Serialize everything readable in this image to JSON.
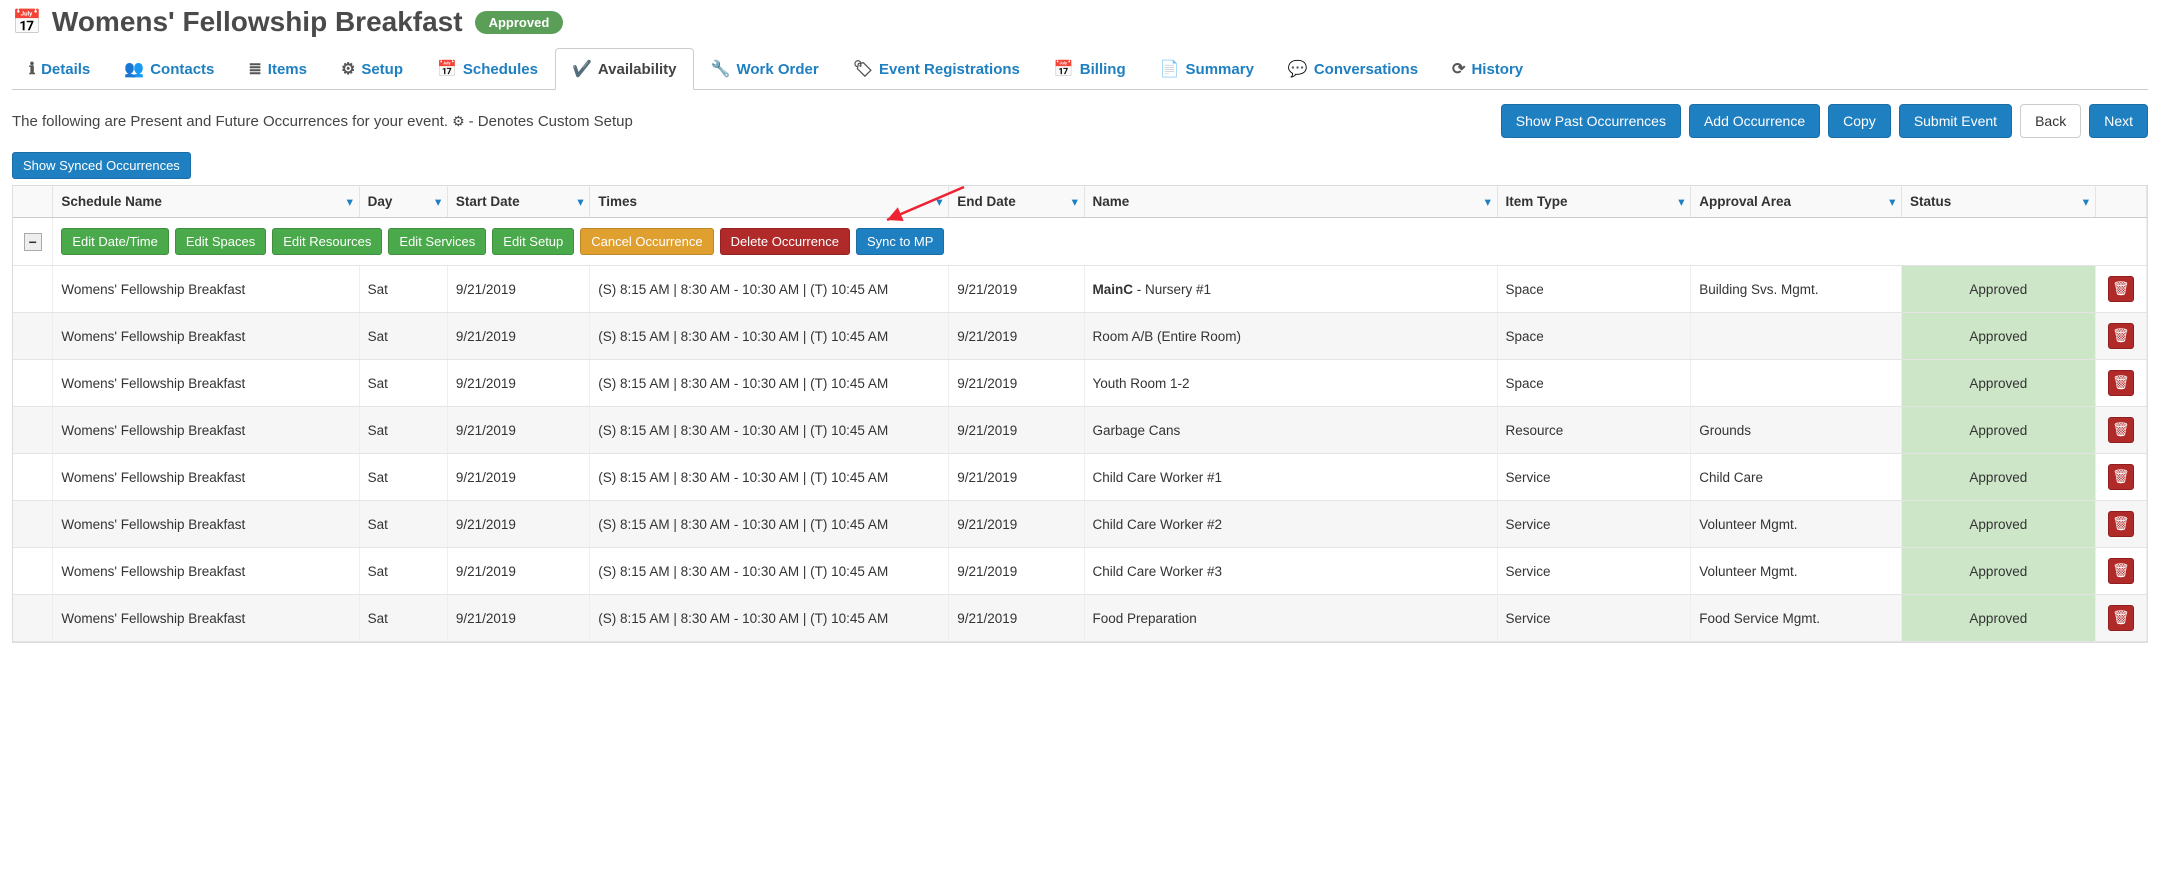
{
  "header": {
    "title": "Womens' Fellowship Breakfast",
    "badge": "Approved"
  },
  "tabs": [
    {
      "id": "details",
      "label": "Details",
      "icon": "ℹ"
    },
    {
      "id": "contacts",
      "label": "Contacts",
      "icon": "👥"
    },
    {
      "id": "items",
      "label": "Items",
      "icon": "≣"
    },
    {
      "id": "setup",
      "label": "Setup",
      "icon": "⚙"
    },
    {
      "id": "schedules",
      "label": "Schedules",
      "icon": "📅"
    },
    {
      "id": "availability",
      "label": "Availability",
      "icon": "✔️",
      "active": true
    },
    {
      "id": "work-order",
      "label": "Work Order",
      "icon": "🔧"
    },
    {
      "id": "event-registrations",
      "label": "Event Registrations",
      "icon": "🏷"
    },
    {
      "id": "billing",
      "label": "Billing",
      "icon": "📅"
    },
    {
      "id": "summary",
      "label": "Summary",
      "icon": "📄"
    },
    {
      "id": "conversations",
      "label": "Conversations",
      "icon": "💬"
    },
    {
      "id": "history",
      "label": "History",
      "icon": "⟳"
    }
  ],
  "info_line": {
    "prefix": "The following are Present and Future Occurrences for your event. ",
    "suffix": " - Denotes Custom Setup"
  },
  "action_buttons": {
    "show_past": "Show Past Occurrences",
    "add_occurrence": "Add Occurrence",
    "copy": "Copy",
    "submit_event": "Submit Event",
    "back": "Back",
    "next": "Next"
  },
  "secondary_button": "Show Synced Occurrences",
  "columns": [
    "Schedule Name",
    "Day",
    "Start Date",
    "Times",
    "End Date",
    "Name",
    "Item Type",
    "Approval Area",
    "Status"
  ],
  "toolbar": {
    "edit_datetime": "Edit Date/Time",
    "edit_spaces": "Edit Spaces",
    "edit_resources": "Edit Resources",
    "edit_services": "Edit Services",
    "edit_setup": "Edit Setup",
    "cancel_occurrence": "Cancel Occurrence",
    "delete_occurrence": "Delete Occurrence",
    "sync_to_mp": "Sync to MP"
  },
  "common": {
    "schedule_name": "Womens' Fellowship Breakfast",
    "day": "Sat",
    "start_date": "9/21/2019",
    "times": "(S) 8:15 AM | 8:30 AM - 10:30 AM | (T) 10:45 AM",
    "end_date": "9/21/2019",
    "status": "Approved"
  },
  "rows": [
    {
      "name_bold": "MainC",
      "name_rest": " - Nursery #1",
      "item_type": "Space",
      "approval_area": "Building Svs. Mgmt."
    },
    {
      "name": "Room A/B (Entire Room)",
      "item_type": "Space",
      "approval_area": ""
    },
    {
      "name": "Youth Room 1-2",
      "item_type": "Space",
      "approval_area": ""
    },
    {
      "name": "Garbage Cans",
      "item_type": "Resource",
      "approval_area": "Grounds"
    },
    {
      "name": "Child Care Worker #1",
      "item_type": "Service",
      "approval_area": "Child Care"
    },
    {
      "name": "Child Care Worker #2",
      "item_type": "Service",
      "approval_area": "Volunteer Mgmt."
    },
    {
      "name": "Child Care Worker #3",
      "item_type": "Service",
      "approval_area": "Volunteer Mgmt."
    },
    {
      "name": "Food Preparation",
      "item_type": "Service",
      "approval_area": "Food Service Mgmt."
    }
  ]
}
